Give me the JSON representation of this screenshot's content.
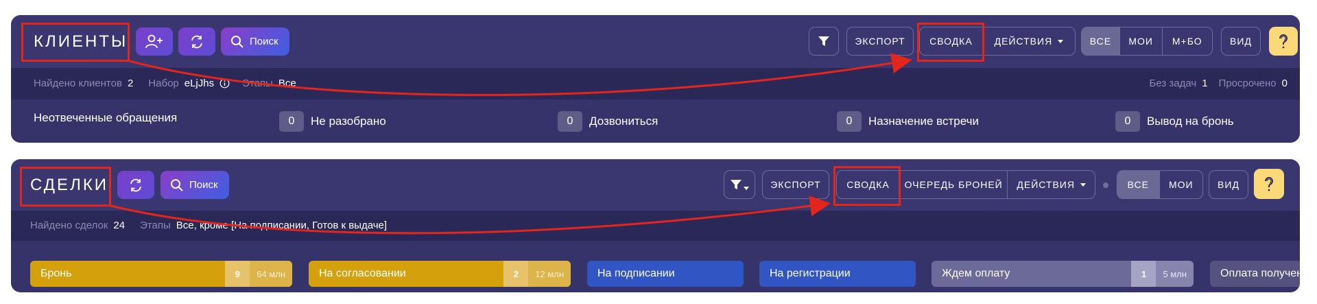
{
  "clients": {
    "title": "КЛИЕНТЫ",
    "search_label": "Поиск",
    "toolbar": {
      "export": "ЭКСПОРТ",
      "summary": "СВОДКА",
      "actions": "ДЕЙСТВИЯ",
      "scope": [
        "ВСЕ",
        "МОИ",
        "М+БО"
      ],
      "view": "ВИД"
    },
    "info": {
      "found_label": "Найдено клиентов",
      "found_value": "2",
      "set_label": "Набор",
      "set_value": "eLjJhs",
      "stages_label": "Этапы",
      "stages_value": "Все",
      "no_tasks_label": "Без задач",
      "no_tasks_value": "1",
      "overdue_label": "Просрочено",
      "overdue_value": "0"
    },
    "stats": [
      {
        "label": "Неотвеченные обращения",
        "count": "0"
      },
      {
        "label": "Не разобрано",
        "count": "0"
      },
      {
        "label": "Дозвониться",
        "count": "0"
      },
      {
        "label": "Назначение встречи",
        "count": "0"
      },
      {
        "label": "Вывод на бронь",
        "count": ""
      }
    ]
  },
  "deals": {
    "title": "СДЕЛКИ",
    "search_label": "Поиск",
    "toolbar": {
      "export": "ЭКСПОРТ",
      "summary": "СВОДКА",
      "queue": "ОЧЕРЕДЬ БРОНЕЙ",
      "actions": "ДЕЙСТВИЯ",
      "scope": [
        "ВСЕ",
        "МОИ"
      ],
      "view": "ВИД"
    },
    "info": {
      "found_label": "Найдено сделок",
      "found_value": "24",
      "stages_label": "Этапы",
      "stages_value": "Все, кроме [На подписании, Готов к выдаче]"
    },
    "stages": [
      {
        "name": "Бронь",
        "count": "9",
        "sum": "64 млн"
      },
      {
        "name": "На согласовании",
        "count": "2",
        "sum": "12 млн"
      },
      {
        "name": "На подписании"
      },
      {
        "name": "На регистрации"
      },
      {
        "name": "Ждем оплату",
        "count": "1",
        "sum": "5 млн"
      },
      {
        "name": "Оплата получен"
      }
    ]
  },
  "colors": {
    "panel": "#2e2b5e",
    "accent_yellow": "#fbd978",
    "highlight_red": "#e3261b",
    "stage_yellow": "#d4a10c",
    "stage_blue": "#3156c4"
  }
}
